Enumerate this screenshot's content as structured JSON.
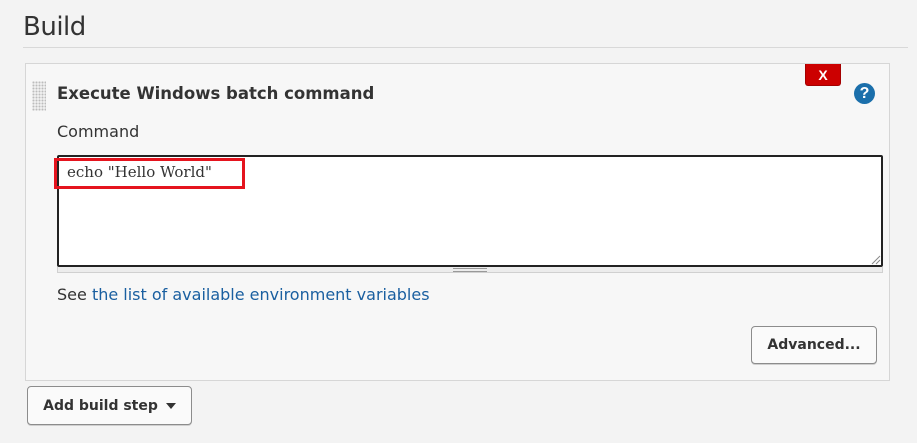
{
  "section": {
    "title": "Build"
  },
  "build_step": {
    "title": "Execute Windows batch command",
    "delete_label": "X",
    "help_label": "?",
    "command_label": "Command",
    "command_value": "echo \"Hello World\"",
    "env_prefix": "See ",
    "env_link_text": "the list of available environment variables",
    "advanced_label": "Advanced..."
  },
  "add_step": {
    "label": "Add build step",
    "icon": "caret-down-icon"
  },
  "colors": {
    "delete": "#cc0000",
    "help": "#1b6fab",
    "link": "#1a5fa0",
    "highlight": "#e5141e"
  }
}
